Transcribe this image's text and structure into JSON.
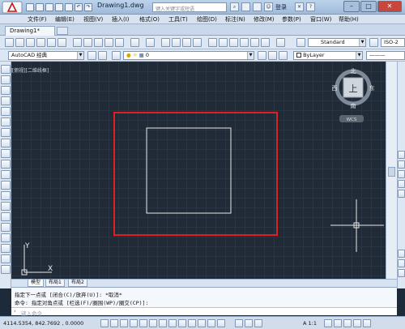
{
  "app": {
    "document_title": "Drawing1.dwg",
    "search_placeholder": "键入关键字或短语",
    "login_label": "登录"
  },
  "menu": {
    "items": [
      "文件(F)",
      "编辑(E)",
      "视图(V)",
      "插入(I)",
      "格式(O)",
      "工具(T)",
      "绘图(D)",
      "标注(N)",
      "修改(M)",
      "参数(P)",
      "窗口(W)",
      "帮助(H)"
    ]
  },
  "file_tab": {
    "label": "Drawing1*"
  },
  "toolbar": {
    "text_style": "Standard",
    "dim_style": "ISO-2",
    "workspace": "AutoCAD 经典",
    "layer": "0",
    "linetype": "ByLayer"
  },
  "viewport": {
    "view_label": "[-][俯视][二维线框]",
    "viewcube": {
      "north": "北",
      "south": "南",
      "east": "东",
      "west": "西",
      "top": "上",
      "wcs": "WCS"
    },
    "ucs": {
      "x": "X",
      "y": "Y"
    }
  },
  "layout_tabs": [
    "模型",
    "布局1",
    "布局2"
  ],
  "command": {
    "history": [
      "指定下一点或 [闭合(C)/放弃(U)]: *取消*",
      "命令: 指定对角点或 [栏选(F)/圈围(WP)/圈交(CP)]:"
    ],
    "input_placeholder": "键入命令"
  },
  "status": {
    "coords": "4114.5354, 842.7692 , 0.0000",
    "scale": "A 1:1"
  },
  "colors": {
    "highlight_rect": "#e02020",
    "drawn_square": "#e8e8e8",
    "canvas_bg": "#212b38"
  }
}
